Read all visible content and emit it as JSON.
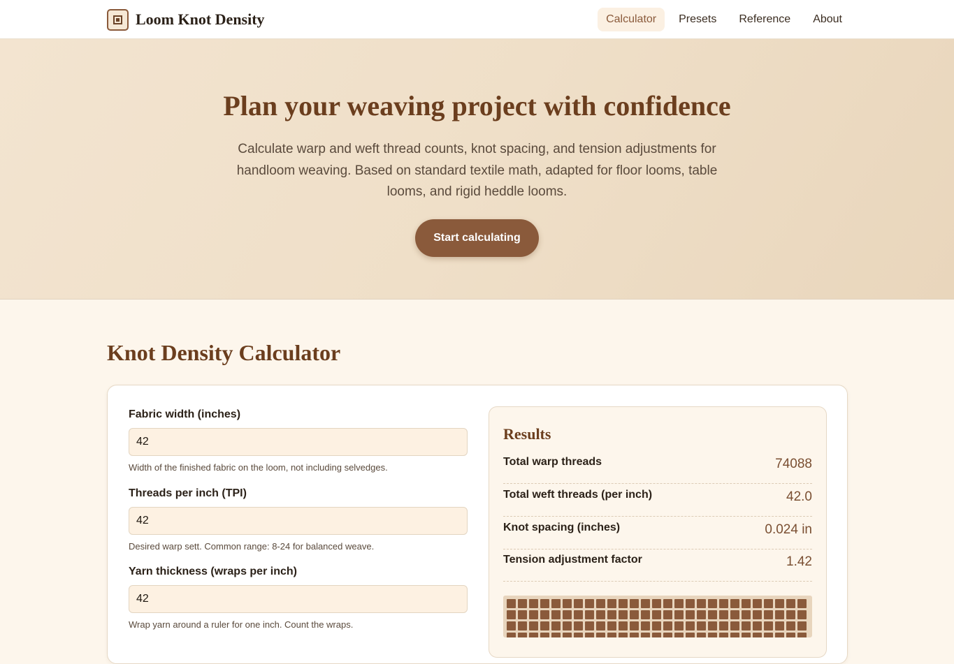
{
  "header": {
    "brand": "Loom Knot Density",
    "nav": [
      {
        "label": "Calculator",
        "active": true
      },
      {
        "label": "Presets",
        "active": false
      },
      {
        "label": "Reference",
        "active": false
      },
      {
        "label": "About",
        "active": false
      }
    ]
  },
  "hero": {
    "title": "Plan your weaving project with confidence",
    "description": "Calculate warp and weft thread counts, knot spacing, and tension adjustments for handloom weaving. Based on standard textile math, adapted for floor looms, table looms, and rigid heddle looms.",
    "cta_label": "Start calculating"
  },
  "calculator": {
    "title": "Knot Density Calculator",
    "fields": [
      {
        "label": "Fabric width (inches)",
        "value": "42",
        "help": "Width of the finished fabric on the loom, not including selvedges."
      },
      {
        "label": "Threads per inch (TPI)",
        "value": "42",
        "help": "Desired warp sett. Common range: 8-24 for balanced weave."
      },
      {
        "label": "Yarn thickness (wraps per inch)",
        "value": "42",
        "help": "Wrap yarn around a ruler for one inch. Count the wraps."
      }
    ],
    "results": {
      "title": "Results",
      "rows": [
        {
          "label": "Total warp threads",
          "value": "74088"
        },
        {
          "label": "Total weft threads (per inch)",
          "value": "42.0"
        },
        {
          "label": "Knot spacing (inches)",
          "value": "0.024 in"
        },
        {
          "label": "Tension adjustment factor",
          "value": "1.42"
        }
      ]
    }
  },
  "colors": {
    "accent": "#8a5a3b",
    "heading": "#6b3e1e",
    "background": "#fdf6ec"
  },
  "icons": {
    "logo": "loom-logo-icon"
  }
}
